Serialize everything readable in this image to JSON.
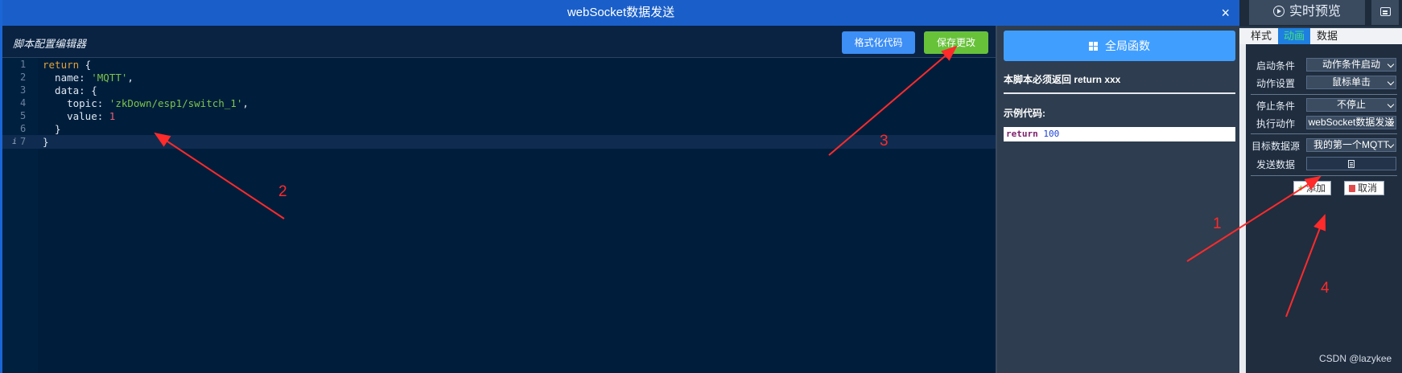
{
  "modal": {
    "title": "webSocket数据发送",
    "close_icon": "×",
    "editor_title": "脚本配置编辑器",
    "format_label": "格式化代码",
    "save_label": "保存更改"
  },
  "code": {
    "line_numbers": [
      "1",
      "2",
      "3",
      "4",
      "5",
      "6",
      "7"
    ],
    "info_marker": "i",
    "lines": [
      [
        "return",
        " {"
      ],
      [
        "  name: ",
        "'MQTT'",
        ","
      ],
      [
        "  data: {"
      ],
      [
        "    topic: ",
        "'zkDown/esp1/switch_1'",
        ","
      ],
      [
        "    value: ",
        "1"
      ],
      [
        "  }"
      ],
      [
        "}"
      ]
    ]
  },
  "side_panel": {
    "global_functions_label": "全局函数",
    "hint": "本脚本必须返回 return xxx",
    "example_label": "示例代码:",
    "example_keyword": "return",
    "example_value": "100"
  },
  "right_panel": {
    "live_preview_label": "实时预览",
    "tabs": [
      "样式",
      "动画",
      "数据"
    ],
    "active_tab": "动画",
    "start_condition": {
      "label": "启动条件",
      "value": "动作条件启动"
    },
    "action_setting": {
      "label": "动作设置",
      "value": "鼠标单击"
    },
    "stop_condition": {
      "label": "停止条件",
      "value": "不停止"
    },
    "execute_action": {
      "label": "执行动作",
      "value": "webSocket数据发送"
    },
    "target_source": {
      "label": "目标数据源",
      "value": "我的第一个MQTT"
    },
    "send_data": {
      "label": "发送数据"
    },
    "add_label": "添加",
    "cancel_label": "取消"
  },
  "annotations": {
    "color": "#ff2a2a",
    "labels": [
      "1",
      "2",
      "3",
      "4"
    ]
  },
  "watermark": "CSDN @lazykee"
}
